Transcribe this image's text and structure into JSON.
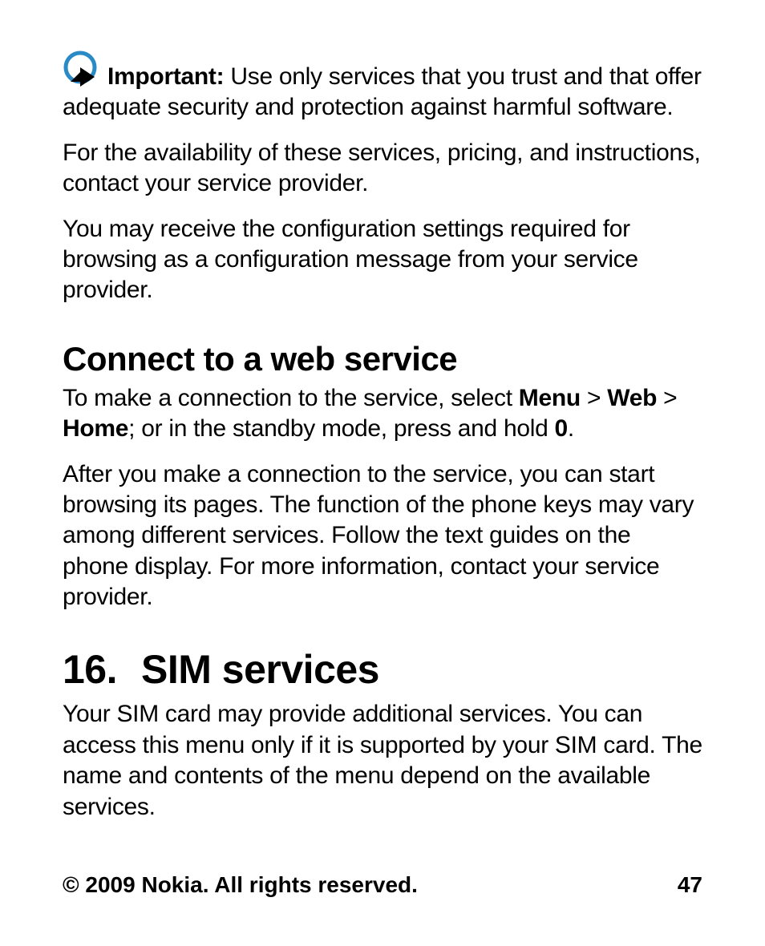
{
  "important": {
    "label": "Important:",
    "text": "Use only services that you trust and that offer adequate security and protection against harmful software."
  },
  "para_availability": "For the availability of these services, pricing, and instructions, contact your service provider.",
  "para_config": "You may receive the configuration settings required for browsing as a configuration message from your service provider.",
  "h2_connect": "Connect to a web service",
  "connect_instr": {
    "pre": "To make a connection to the service, select ",
    "menu": "Menu",
    "gt1": " > ",
    "web": "Web",
    "gt2": " > ",
    "home": "Home",
    "mid": "; or in the standby mode, press and hold ",
    "zero": "0",
    "post": "."
  },
  "para_after_connect": "After you make a connection to the service, you can start browsing its pages. The function of the phone keys may vary among different services. Follow the text guides on the phone display. For more information, contact your service provider.",
  "h1_sim": {
    "num": "16.",
    "title": "SIM services"
  },
  "para_sim": "Your SIM card may provide additional services. You can access this menu only if it is supported by your SIM card. The name and contents of the menu depend on the available services.",
  "footer": {
    "copyright": "© 2009 Nokia. All rights reserved.",
    "page": "47"
  }
}
